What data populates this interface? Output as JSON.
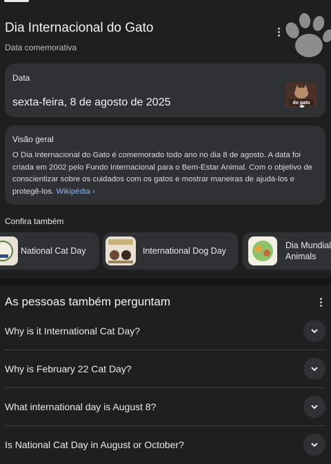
{
  "header": {
    "title": "Dia Internacional do Gato",
    "subtitle": "Data comemorativa"
  },
  "date_card": {
    "label": "Data",
    "value": "sexta-feira, 8 de agosto de 2025",
    "thumb_caption": "do gato"
  },
  "overview": {
    "label": "Visão geral",
    "text": "O Dia Internacional do Gato é comemorado todo ano no dia 8 de agosto. A data foi criada em 2002 pelo Fundo Internacional para o Bem-Estar Animal. Com o objetivo de conscientizar sobre os cuidados com os gatos e mostrar maneiras de ajudá-los e protegê-los.",
    "source_link": "Wikipédia ›"
  },
  "see_also": {
    "label": "Confira também",
    "chips": [
      {
        "label": "National Cat Day"
      },
      {
        "label": "International Dog Day"
      },
      {
        "label": "Dia Mundial",
        "label2": "Animals"
      }
    ]
  },
  "people_also_ask": {
    "title": "As pessoas também perguntam",
    "questions": [
      "Why is it International Cat Day?",
      "Why is February 22 Cat Day?",
      "What international day is August 8?",
      "Is National Cat Day in August or October?"
    ]
  },
  "colors": {
    "background": "#1f1f1f",
    "card": "#303134",
    "link": "#8ab4f8"
  },
  "icons": [
    "paw-print-icon",
    "more-vert-icon",
    "chevron-down-icon"
  ]
}
